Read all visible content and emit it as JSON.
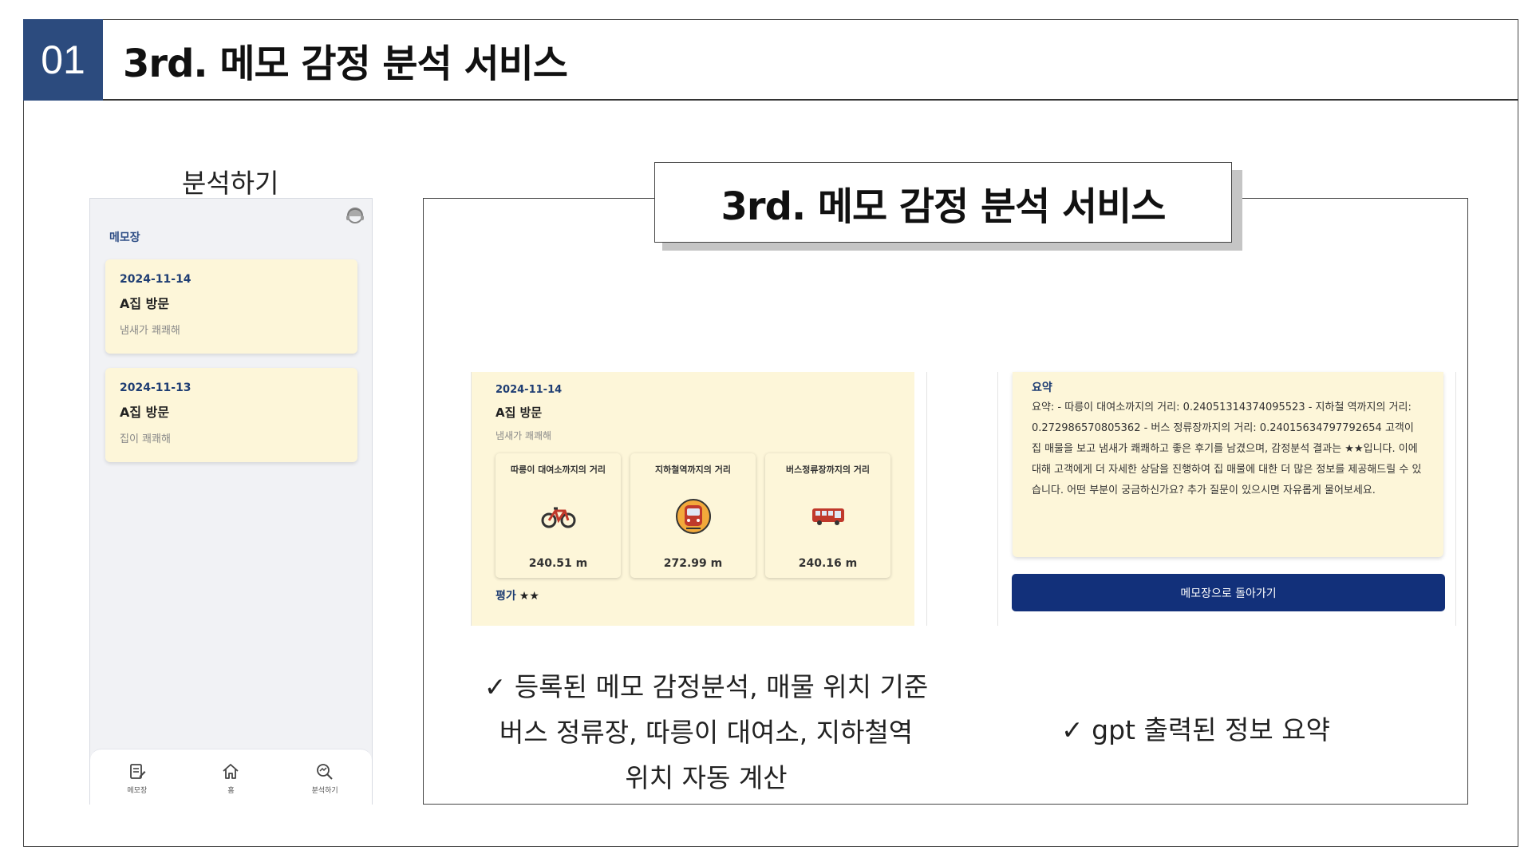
{
  "slide": {
    "number": "01",
    "title": "3rd. 메모 감정 분석 서비스"
  },
  "phone": {
    "caption": "분석하기",
    "section_title": "메모장",
    "memos": [
      {
        "date": "2024-11-14",
        "title": "A집 방문",
        "body": "냄새가 쾌쾌해"
      },
      {
        "date": "2024-11-13",
        "title": "A집 방문",
        "body": "집이 쾌쾌해"
      }
    ],
    "nav": {
      "memo_label": "메모장",
      "home_label": "홈",
      "analyze_label": "분석하기"
    }
  },
  "panel": {
    "title": "3rd. 메모 감정 분석 서비스",
    "analysis": {
      "date": "2024-11-14",
      "title": "A집 방문",
      "body": "냄새가 쾌쾌해",
      "distances": [
        {
          "label": "따릉이 대여소까지의 거리",
          "icon": "bicycle-icon",
          "value": "240.51 m"
        },
        {
          "label": "지하철역까지의 거리",
          "icon": "subway-icon",
          "value": "272.99 m"
        },
        {
          "label": "버스정류장까지의 거리",
          "icon": "bus-icon",
          "value": "240.16 m"
        }
      ],
      "rating_label": "평가",
      "rating_stars": "★★"
    },
    "summary": {
      "title": "요약",
      "text": "요약: - 따릉이 대여소까지의 거리: 0.24051314374095523 - 지하철 역까지의 거리: 0.272986570805362 - 버스 정류장까지의 거리: 0.24015634797792654 고객이 집 매물을 보고 냄새가 쾌쾌하고 좋은 후기를 남겼으며, 감정분석 결과는 ★★입니다. 이에 대해 고객에게 더 자세한 상담을 진행하여 집 매물에 대한 더 많은 정보를 제공해드릴 수 있습니다. 어떤 부분이 궁금하신가요? 추가 질문이 있으시면 자유롭게 물어보세요.",
      "button_label": "메모장으로 돌아가기"
    },
    "caption_left_lines": [
      "✓ 등록된 메모 감정분석, 매물 위치 기준",
      "버스 정류장, 따릉이 대여소, 지하철역",
      "위치 자동 계산"
    ],
    "caption_right": "✓ gpt 출력된 정보 요약"
  },
  "colors": {
    "badge": "#2c4b7e",
    "card": "#fdf6d9",
    "accent_text": "#1e3d73",
    "button": "#12307a"
  }
}
